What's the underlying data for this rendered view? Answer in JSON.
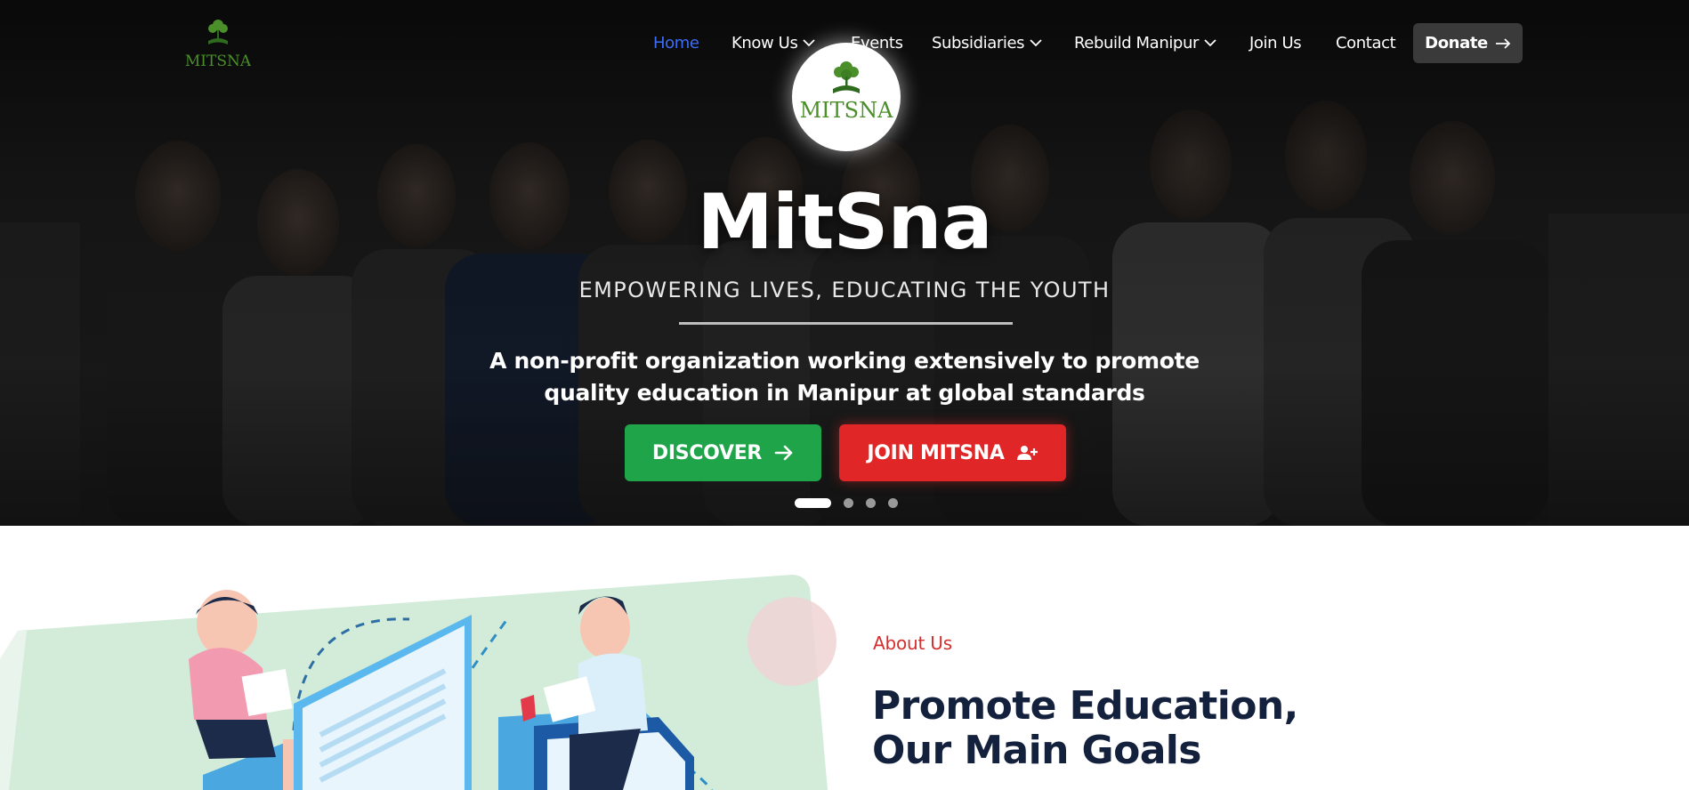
{
  "brand": {
    "logo_text": "MITSNA",
    "green": "#4a8f2a",
    "dark_green": "#2f6b1f"
  },
  "nav": {
    "items": [
      {
        "label": "Home",
        "active": true,
        "dropdown": false
      },
      {
        "label": "Know Us",
        "active": false,
        "dropdown": true
      },
      {
        "label": "Events",
        "active": false,
        "dropdown": false
      },
      {
        "label": "Subsidiaries",
        "active": false,
        "dropdown": true
      },
      {
        "label": "Rebuild Manipur",
        "active": false,
        "dropdown": true
      },
      {
        "label": "Join Us",
        "active": false,
        "dropdown": false
      },
      {
        "label": "Contact",
        "active": false,
        "dropdown": false
      }
    ],
    "donate_label": "Donate",
    "active_color": "#3b6ef5"
  },
  "hero": {
    "title": "MitSna",
    "subtitle": "EMPOWERING LIVES, EDUCATING THE YOUTH",
    "description": "A non-profit organization working extensively to promote quality education in Manipur at global standards",
    "discover_label": "DISCOVER",
    "join_label": "JOIN MITSNA",
    "discover_color": "#1fa44a",
    "join_color": "#e02626",
    "slides_count": 4,
    "active_slide": 1
  },
  "about": {
    "eyebrow": "About Us",
    "heading_line1": "Promote Education,",
    "heading_line2": "Our Main Goals"
  }
}
